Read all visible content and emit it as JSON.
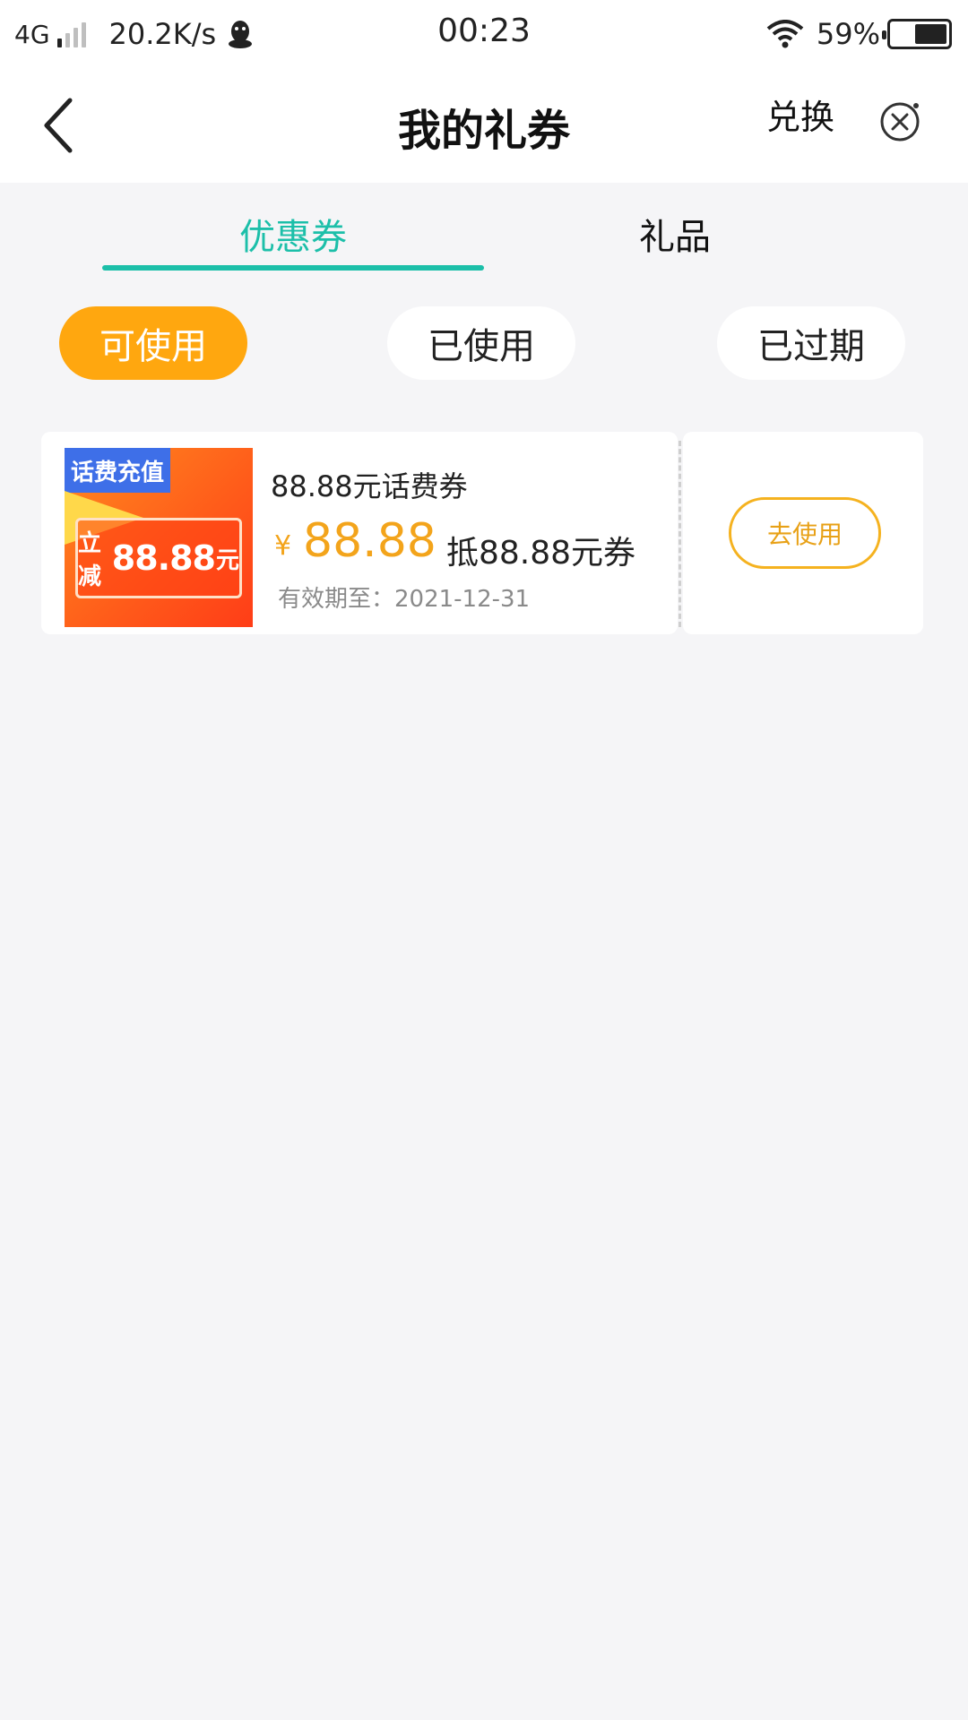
{
  "status_bar": {
    "network": "4G",
    "speed": "20.2K/s",
    "time": "00:23",
    "battery_percent": "59%",
    "battery_level": 0.59
  },
  "header": {
    "title": "我的礼券",
    "exchange_label": "兑换"
  },
  "tabs": [
    {
      "label": "优惠券",
      "active": true
    },
    {
      "label": "礼品",
      "active": false
    }
  ],
  "filters": [
    {
      "label": "可使用",
      "active": true
    },
    {
      "label": "已使用",
      "active": false
    },
    {
      "label": "已过期",
      "active": false
    }
  ],
  "coupons": [
    {
      "thumb_tag": "话费充值",
      "thumb_prefix": "立减",
      "thumb_amount": "88.88",
      "thumb_suffix": "元",
      "title": "88.88元话费券",
      "currency": "¥",
      "amount": "88.88",
      "description": "抵88.88元券",
      "expiry": "有效期至：2021-12-31",
      "action_label": "去使用"
    }
  ],
  "colors": {
    "accent_teal": "#1cbfa9",
    "accent_orange": "#ffa70f",
    "price_orange": "#f3a41b",
    "tag_blue": "#3e6fe8"
  },
  "icons": {
    "back": "chevron-left-icon",
    "close": "close-circle-icon",
    "qq": "qq-penguin-icon",
    "wifi": "wifi-icon",
    "battery": "battery-icon"
  }
}
